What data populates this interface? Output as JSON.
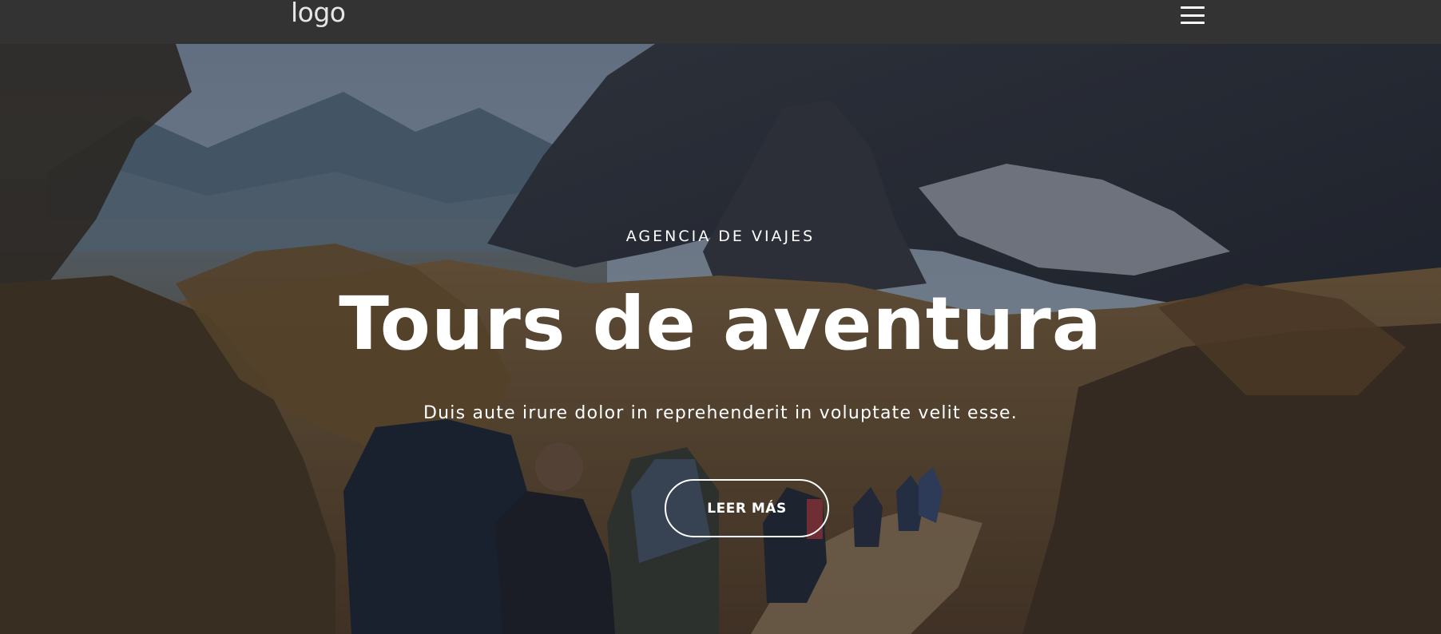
{
  "navbar": {
    "logo_text": "logo",
    "menu_icon": "hamburger-menu-icon"
  },
  "hero": {
    "eyebrow": "AGENCIA DE VIAJES",
    "title": "Tours de aventura",
    "subtitle": "Duis aute irure dolor in reprehenderit in voluptate velit esse.",
    "cta_label": "LEER MÁS"
  },
  "colors": {
    "navbar_bg": "#333333",
    "text": "#ffffff"
  }
}
